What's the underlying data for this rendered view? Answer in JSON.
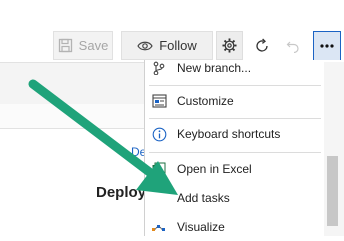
{
  "toolbar": {
    "save_label": "Save",
    "follow_label": "Follow",
    "icons": {
      "save": "save-icon",
      "follow": "eye-icon",
      "settings": "gear-icon",
      "refresh": "refresh-icon",
      "undo": "undo-icon",
      "more": "more-actions-icon"
    }
  },
  "background": {
    "link_text": "De",
    "heading": "Deploy"
  },
  "menu": {
    "items": [
      {
        "label": "New branch...",
        "icon": "branch-icon"
      },
      {
        "label": "Customize",
        "icon": "customize-icon"
      },
      {
        "label": "Keyboard shortcuts",
        "icon": "info-icon"
      },
      {
        "label": "Open in Excel",
        "icon": "excel-icon"
      },
      {
        "label": "Add tasks",
        "icon": "add-tasks-icon"
      },
      {
        "label": "Visualize",
        "icon": "visualize-icon"
      }
    ]
  },
  "annotation": {
    "arrow_color": "#1fa37a"
  },
  "colors": {
    "accent": "#1b63c4",
    "more_button_bg": "#dbe6f4"
  }
}
